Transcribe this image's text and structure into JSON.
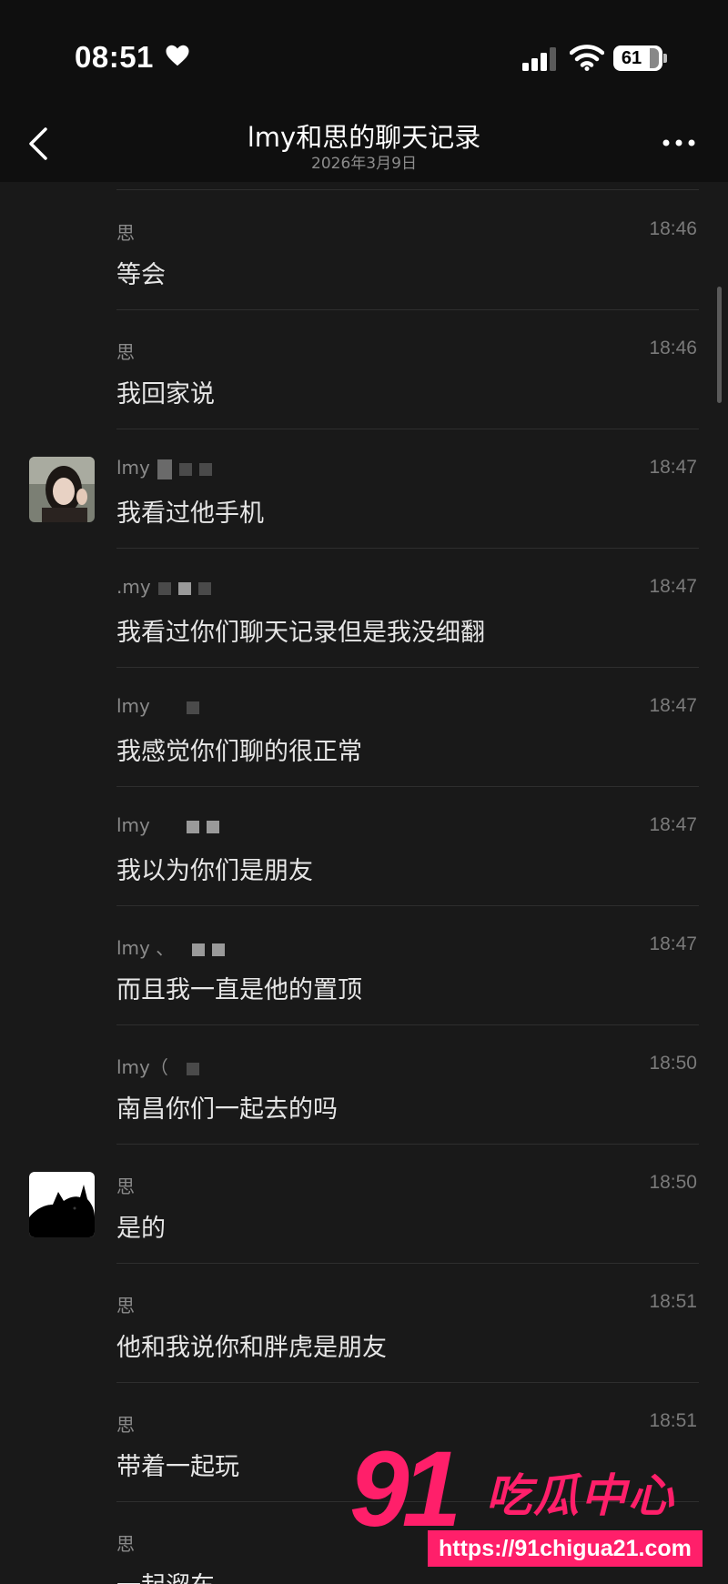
{
  "status_bar": {
    "time": "08:51",
    "battery": "61",
    "battery_level_percent": 61,
    "icons": [
      "heart-icon",
      "signal-icon",
      "wifi-icon",
      "battery-icon"
    ]
  },
  "nav": {
    "title": "lmy和思的聊天记录",
    "subtitle": "2026年3月9日",
    "icons": [
      "back-chevron-icon",
      "more-dots-icon"
    ]
  },
  "messages": [
    {
      "sender": "思",
      "time": "18:46",
      "text": "等会",
      "avatar": null
    },
    {
      "sender": "思",
      "time": "18:46",
      "text": "我回家说",
      "avatar": null
    },
    {
      "sender": "lmy",
      "time": "18:47",
      "text": "我看过他手机",
      "avatar": "selfie-avatar"
    },
    {
      "sender": ".my",
      "time": "18:47",
      "text": "我看过你们聊天记录但是我没细翻",
      "avatar": null
    },
    {
      "sender": "lmy",
      "time": "18:47",
      "text": "我感觉你们聊的很正常",
      "avatar": null
    },
    {
      "sender": "lmy",
      "time": "18:47",
      "text": "我以为你们是朋友",
      "avatar": null
    },
    {
      "sender": "lmy 、",
      "time": "18:47",
      "text": "而且我一直是他的置顶",
      "avatar": null
    },
    {
      "sender": "lmy（",
      "time": "18:50",
      "text": "南昌你们一起去的吗",
      "avatar": null
    },
    {
      "sender": "思",
      "time": "18:50",
      "text": "是的",
      "avatar": "cat-avatar"
    },
    {
      "sender": "思",
      "time": "18:51",
      "text": "他和我说你和胖虎是朋友",
      "avatar": null
    },
    {
      "sender": "思",
      "time": "18:51",
      "text": "带着一起玩",
      "avatar": null
    },
    {
      "sender": "思",
      "time": "18:51",
      "text": "一起溜车",
      "avatar": null
    }
  ],
  "colors": {
    "background": "#191919",
    "header": "#0f0f0f",
    "text": "#e6e6e6",
    "muted": "#8a8a8a",
    "watermark": "#ff1f6a"
  },
  "watermark": {
    "logo": "91",
    "brand": "吃瓜中心",
    "url": "https://91chigua21.com"
  }
}
